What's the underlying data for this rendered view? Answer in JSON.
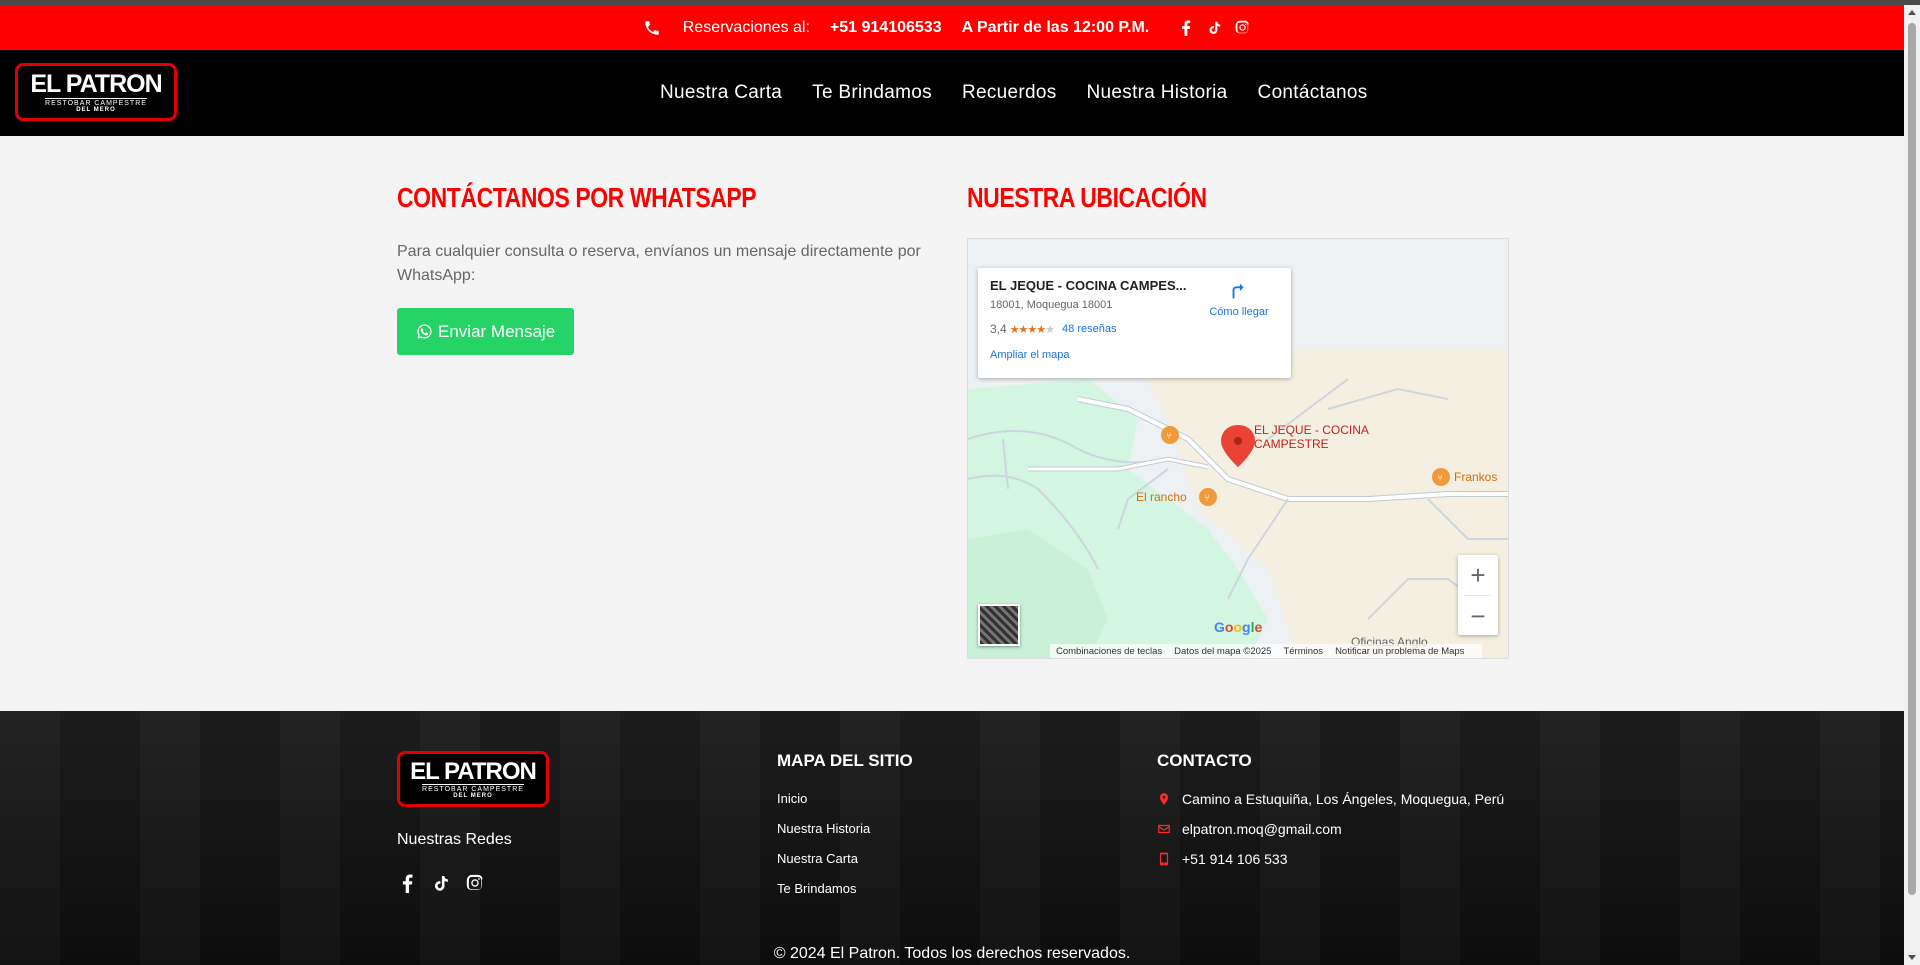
{
  "topbar": {
    "reservations_label": "Reservaciones al:",
    "phone": "+51 914106533",
    "hours": "A Partir de las 12:00 P.M.",
    "icons": [
      "phone-icon",
      "facebook-icon",
      "tiktok-icon",
      "instagram-icon"
    ]
  },
  "header": {
    "logo": {
      "main": "EL PATRON",
      "sub": "RESTOBAR CAMPESTRE",
      "sub2": "DEL MERO"
    },
    "nav": [
      "Nuestra Carta",
      "Te Brindamos",
      "Recuerdos",
      "Nuestra Historia",
      "Contáctanos"
    ]
  },
  "contact": {
    "title": "CONTÁCTANOS POR WHATSAPP",
    "description": "Para cualquier consulta o reserva, envíanos un mensaje directamente por WhatsApp:",
    "button_label": "Enviar Mensaje"
  },
  "location": {
    "title": "NUESTRA UBICACIÓN",
    "map": {
      "place_name": "EL JEQUE - COCINA CAMPES...",
      "address": "18001, Moquegua 18001",
      "rating": "3,4",
      "stars": 3.4,
      "reviews": "48 reseñas",
      "enlarge": "Ampliar el mapa",
      "directions": "Cómo llegar",
      "marker_label_line1": "EL JEQUE - COCINA",
      "marker_label_line2": "CAMPESTRE",
      "poi_rancho": "El rancho",
      "poi_frankos": "Frankos",
      "poi_oficinas": "Oficinas Anglo",
      "zoom_in": "+",
      "zoom_out": "−",
      "google": "Google",
      "footer": [
        "Combinaciones de teclas",
        "Datos del mapa ©2025",
        "Términos",
        "Notificar un problema de Maps"
      ]
    }
  },
  "footer": {
    "logo": {
      "main": "EL PATRON",
      "sub": "RESTOBAR CAMPESTRE",
      "sub2": "DEL MERO"
    },
    "redes_label": "Nuestras Redes",
    "sitemap_title": "MAPA DEL SITIO",
    "sitemap_links": [
      "Inicio",
      "Nuestra Historia",
      "Nuestra Carta",
      "Te Brindamos"
    ],
    "contact_title": "CONTACTO",
    "address": "Camino a Estuquiña, Los Ángeles, Moquegua, Perú",
    "email": "elpatron.moq@gmail.com",
    "phone": "+51 914 106 533",
    "copyright": "© 2024 El Patron. Todos los derechos reservados."
  },
  "colors": {
    "accent": "#ff0000",
    "whatsapp": "#25d366",
    "header_bg": "#000000",
    "link": "#1a73e8"
  }
}
